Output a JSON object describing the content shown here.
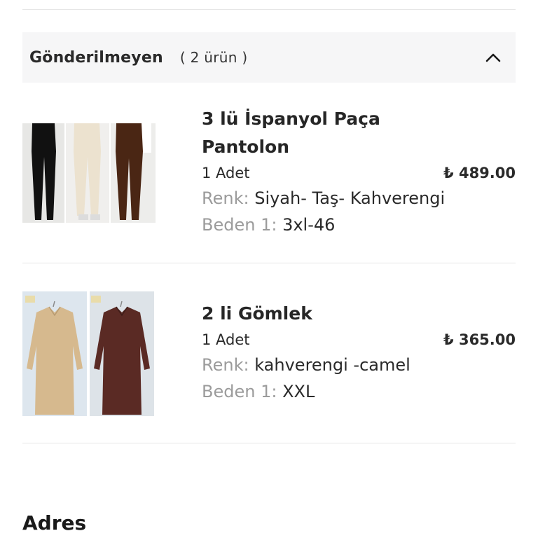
{
  "section": {
    "title": "Gönderilmeyen",
    "count": "( 2 ürün )"
  },
  "products": [
    {
      "title_line1": "3 lü İspanyol Paça",
      "title_line2": "Pantolon",
      "quantity": "1 Adet",
      "price": "₺ 489.00",
      "color_label": "Renk:",
      "color_value": "Siyah- Taş- Kahverengi",
      "size_label": "Beden 1:",
      "size_value": "3xl-46",
      "image": "three-flare-pants-black-stone-brown"
    },
    {
      "title_line1": "2 li Gömlek",
      "quantity": "1 Adet",
      "price": "₺ 365.00",
      "color_label": "Renk:",
      "color_value": "kahverengi -camel",
      "size_label": "Beden 1:",
      "size_value": "XXL",
      "image": "two-shirts-camel-brown"
    }
  ],
  "address": {
    "title": "Adres"
  },
  "colors": {
    "header_bg": "#f6f6f7",
    "divider": "#e6e6e6",
    "label_gray": "#9b9b9b",
    "text_dark": "#2a2a2a"
  }
}
